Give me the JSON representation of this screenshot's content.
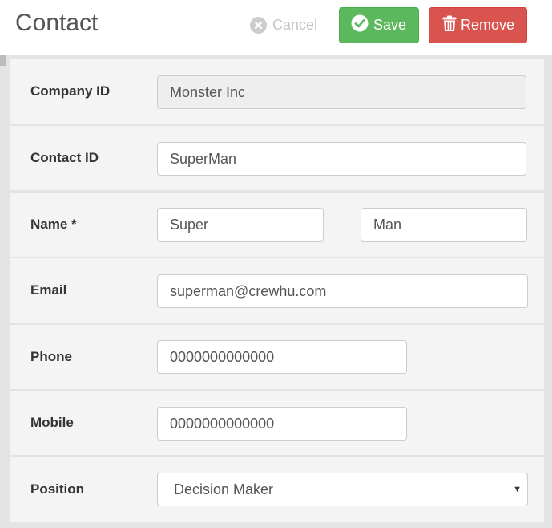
{
  "header": {
    "title": "Contact",
    "cancel_label": "Cancel",
    "save_label": "Save",
    "remove_label": "Remove"
  },
  "form": {
    "company_id": {
      "label": "Company ID",
      "value": "Monster Inc"
    },
    "contact_id": {
      "label": "Contact ID",
      "value": "SuperMan"
    },
    "name": {
      "label": "Name *",
      "first": "Super",
      "last": "Man"
    },
    "email": {
      "label": "Email",
      "value": "superman@crewhu.com"
    },
    "phone": {
      "label": "Phone",
      "value": "0000000000000"
    },
    "mobile": {
      "label": "Mobile",
      "value": "0000000000000"
    },
    "position": {
      "label": "Position",
      "value": "Decision Maker"
    }
  },
  "colors": {
    "save": "#5cb85c",
    "remove": "#d9534f",
    "cancel": "#c6c6c6"
  },
  "icons": {
    "cancel": "times-circle-icon",
    "save": "check-circle-icon",
    "remove": "trash-icon",
    "select": "caret-down-icon"
  }
}
